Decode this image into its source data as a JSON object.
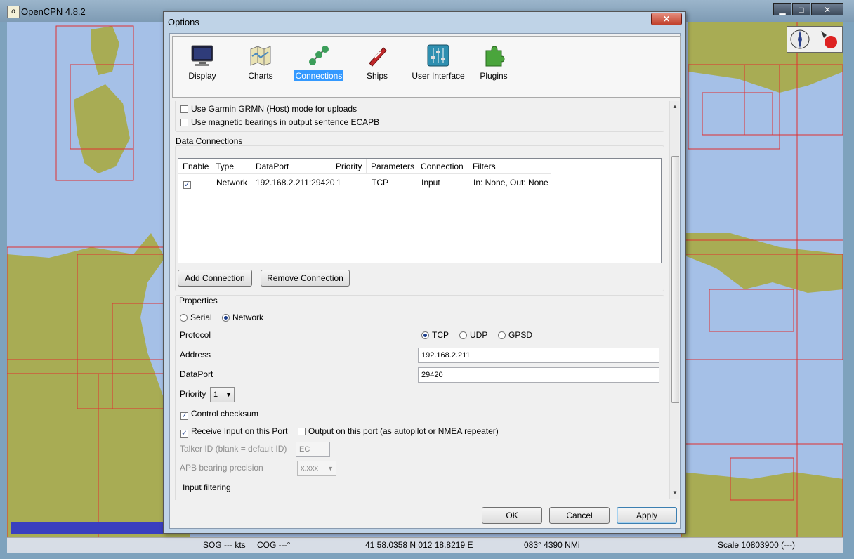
{
  "main_window": {
    "title": "OpenCPN 4.8.2",
    "app_icon_glyph": "o",
    "minimize_glyph": "▁",
    "maximize_glyph": "□",
    "close_glyph": "✕"
  },
  "status_bar": {
    "sog": "SOG --- kts",
    "cog": "COG ---°",
    "position": "41 58.0358 N   012 18.8219 E",
    "bearing": "083°  4390 NMi",
    "scale": "Scale 10803900 (---)"
  },
  "dialog": {
    "title": "Options",
    "close_glyph": "✕",
    "toolbar": [
      {
        "label": "Display",
        "icon": "monitor-icon"
      },
      {
        "label": "Charts",
        "icon": "charts-icon"
      },
      {
        "label": "Connections",
        "icon": "connections-icon",
        "selected": true
      },
      {
        "label": "Ships",
        "icon": "ship-icon"
      },
      {
        "label": "User Interface",
        "icon": "sliders-icon"
      },
      {
        "label": "Plugins",
        "icon": "puzzle-icon"
      }
    ],
    "general": {
      "garmin": "Use Garmin GRMN (Host) mode for uploads",
      "magnetic": "Use magnetic bearings in output sentence ECAPB"
    },
    "data_connections": {
      "title": "Data Connections",
      "columns": [
        "Enable",
        "Type",
        "DataPort",
        "Priority",
        "Parameters",
        "Connection",
        "Filters"
      ],
      "rows": [
        {
          "enabled": true,
          "type": "Network",
          "dataport": "192.168.2.211:29420",
          "priority": "1",
          "parameters": "TCP",
          "connection": "Input",
          "filters": "In: None, Out: None"
        }
      ],
      "add_button": "Add Connection",
      "remove_button": "Remove Connection"
    },
    "properties": {
      "title": "Properties",
      "serial_label": "Serial",
      "network_label": "Network",
      "selected_type": "Network",
      "protocol_label": "Protocol",
      "protocol_options": [
        "TCP",
        "UDP",
        "GPSD"
      ],
      "protocol_selected": "TCP",
      "address_label": "Address",
      "address_value": "192.168.2.211",
      "dataport_label": "DataPort",
      "dataport_value": "29420",
      "priority_label": "Priority",
      "priority_value": "1",
      "control_checksum": "Control checksum",
      "receive_input": "Receive Input on this Port",
      "output_port": "Output on this port (as autopilot or NMEA repeater)",
      "talker_label": "Talker ID (blank = default ID)",
      "talker_value": "EC",
      "apb_label": "APB bearing precision",
      "apb_value": "x.xxx",
      "input_filtering": "Input filtering"
    },
    "buttons": {
      "ok": "OK",
      "cancel": "Cancel",
      "apply": "Apply"
    },
    "colors": {
      "selection": "#3399ff",
      "land": "#a8ac54",
      "water": "#a5c0e7",
      "chart_outline": "#e03030"
    }
  }
}
